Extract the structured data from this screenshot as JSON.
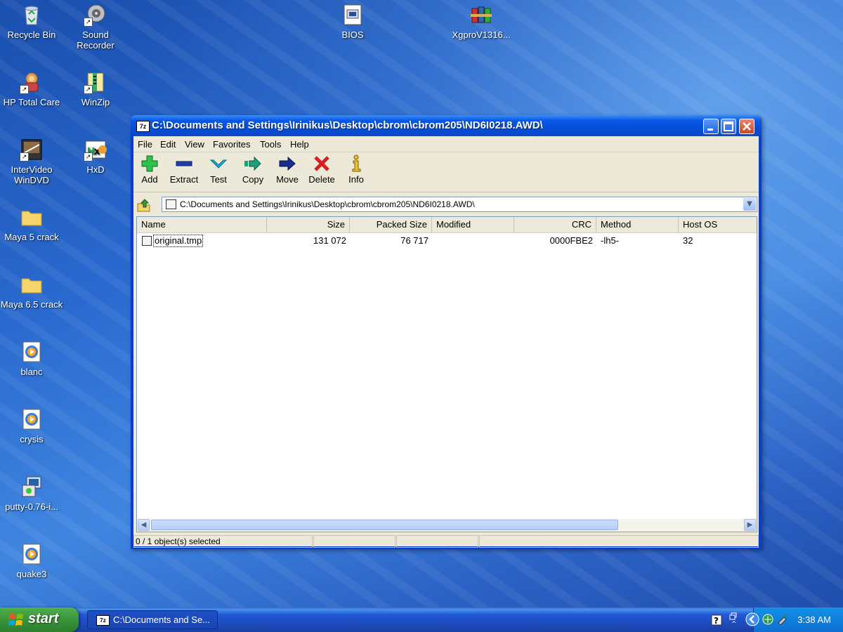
{
  "desktop": {
    "icons": [
      {
        "label": "Recycle Bin",
        "icon": "recycle-bin-icon"
      },
      {
        "label": "Sound Recorder",
        "icon": "sound-recorder-icon"
      },
      {
        "label": "BIOS",
        "icon": "bios-file-icon"
      },
      {
        "label": "XgproV1316...",
        "icon": "winrar-archive-icon"
      },
      {
        "label": "HP Total Care",
        "icon": "hp-total-care-icon"
      },
      {
        "label": "WinZip",
        "icon": "winzip-icon"
      },
      {
        "label": "InterVideo WinDVD",
        "icon": "windvd-icon"
      },
      {
        "label": "HxD",
        "icon": "hxd-icon"
      },
      {
        "label": "Maya 5 crack",
        "icon": "folder-icon"
      },
      {
        "label": "Maya 6.5 crack",
        "icon": "folder-icon"
      },
      {
        "label": "blanc",
        "icon": "media-file-icon"
      },
      {
        "label": "crysis",
        "icon": "media-file-icon"
      },
      {
        "label": "putty-0.76-i...",
        "icon": "installer-icon"
      },
      {
        "label": "quake3",
        "icon": "media-file-icon"
      }
    ]
  },
  "window": {
    "title": "C:\\Documents and Settings\\Irinikus\\Desktop\\cbrom\\cbrom205\\ND6I0218.AWD\\",
    "app_icon_text": "7z",
    "menu": [
      "File",
      "Edit",
      "View",
      "Favorites",
      "Tools",
      "Help"
    ],
    "toolbar": [
      {
        "label": "Add",
        "icon": "add-icon",
        "color": "#22b14c"
      },
      {
        "label": "Extract",
        "icon": "extract-icon",
        "color": "#1f3fae"
      },
      {
        "label": "Test",
        "icon": "test-icon",
        "color": "#19a6c6"
      },
      {
        "label": "Copy",
        "icon": "copy-icon",
        "color": "#1aa07a"
      },
      {
        "label": "Move",
        "icon": "move-icon",
        "color": "#1a2f8c"
      },
      {
        "label": "Delete",
        "icon": "delete-icon",
        "color": "#d81e1e"
      },
      {
        "label": "Info",
        "icon": "info-icon",
        "color": "#d8b41e"
      }
    ],
    "address": "C:\\Documents and Settings\\Irinikus\\Desktop\\cbrom\\cbrom205\\ND6I0218.AWD\\",
    "columns": [
      "Name",
      "Size",
      "Packed Size",
      "Modified",
      "CRC",
      "Method",
      "Host OS"
    ],
    "rows": [
      {
        "name": "original.tmp",
        "size": "131 072",
        "packed": "76 717",
        "modified": "",
        "crc": "0000FBE2",
        "method": "-lh5-",
        "host_os": "32"
      }
    ],
    "status": [
      "0 / 1 object(s) selected",
      "",
      "",
      ""
    ]
  },
  "taskbar": {
    "start_label": "start",
    "task_label": "C:\\Documents and Se...",
    "task_icon_text": "7z",
    "clock": "3:38 AM"
  },
  "colors": {
    "titlebar": "#0a58e8",
    "window_body": "#ece9d8",
    "start": "#3c9a3c",
    "taskbar": "#2157d7",
    "tray": "#0e6fd1"
  }
}
